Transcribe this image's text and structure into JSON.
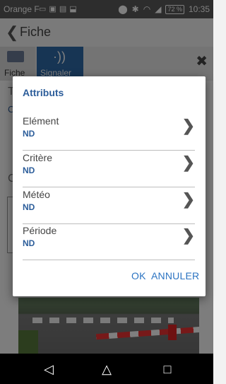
{
  "status_bar": {
    "carrier": "Orange F",
    "battery": "72 %",
    "time": "10:35",
    "left_icons": [
      "message-icon",
      "flipboard-icon",
      "gallery-icon",
      "android-icon"
    ],
    "right_icons": [
      "location-icon",
      "bluetooth-icon",
      "wifi-icon",
      "signal-icon"
    ]
  },
  "app": {
    "title": "Fiche",
    "tabs": [
      {
        "label": "Fiche"
      },
      {
        "label": "Signaler",
        "active": true
      }
    ]
  },
  "dialog": {
    "title": "Attributs",
    "rows": [
      {
        "label": "Elément",
        "value": "ND"
      },
      {
        "label": "Critère",
        "value": "ND"
      },
      {
        "label": "Météo",
        "value": "ND"
      },
      {
        "label": "Période",
        "value": "ND"
      }
    ],
    "ok_label": "OK",
    "cancel_label": "ANNULER"
  },
  "nav_bar": {
    "buttons": [
      "back-icon",
      "home-icon",
      "recents-icon"
    ]
  },
  "colors": {
    "accent": "#2c5d9a",
    "button_text": "#2c74c2",
    "active_tab": "#2f6aa8"
  }
}
